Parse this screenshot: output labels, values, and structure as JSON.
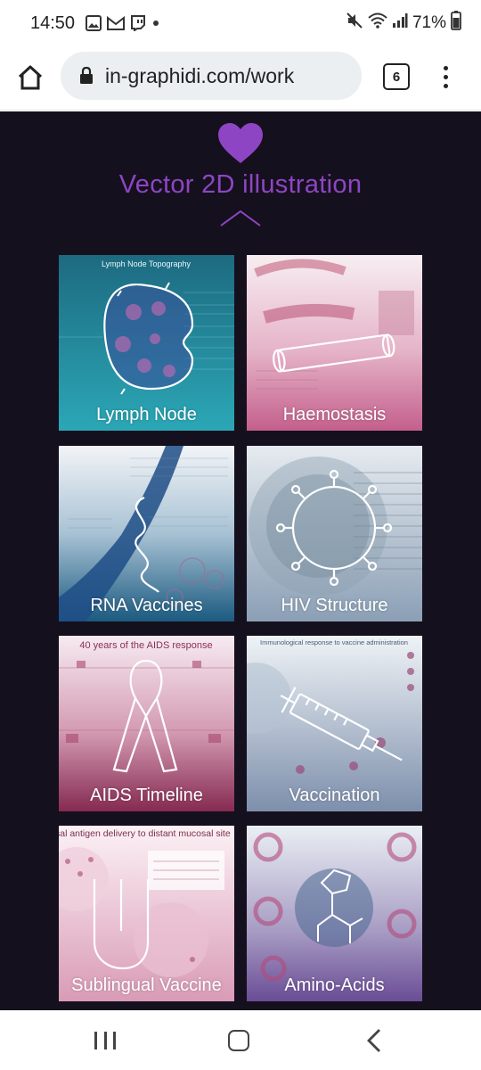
{
  "status_bar": {
    "time": "14:50",
    "notification_icons": [
      "gallery-icon",
      "gmail-icon",
      "twitch-icon",
      "dot-icon"
    ],
    "system_icons": [
      "mute-icon",
      "wifi-icon",
      "signal-icon"
    ],
    "battery_text": "71%"
  },
  "browser": {
    "url": "in-graphidi.com/work",
    "tab_count": "6"
  },
  "section": {
    "title": "Vector 2D illustration",
    "accent_color": "#8e45c4",
    "background_color": "#15101d"
  },
  "cards": [
    {
      "label": "Lymph Node",
      "art_text": "Lymph Node Topography",
      "color_top": "#1f6f86",
      "color_bottom": "#2aa3b3"
    },
    {
      "label": "Haemostasis",
      "art_text": "",
      "color_top": "#f6eaf0",
      "color_bottom": "#c9648f"
    },
    {
      "label": "RNA Vaccines",
      "art_text": "",
      "color_top": "#eef1f4",
      "color_bottom": "#1e5f86"
    },
    {
      "label": "HIV Structure",
      "art_text": "",
      "color_top": "#e3e9ee",
      "color_bottom": "#8fa3b8"
    },
    {
      "label": "AIDS Timeline",
      "art_text": "40 years of the AIDS response",
      "color_top": "#f5e7ee",
      "color_bottom": "#8a2e55"
    },
    {
      "label": "Vaccination",
      "art_text": "Immunological response to vaccine administration",
      "color_top": "#eef2f5",
      "color_bottom": "#7f90ad"
    },
    {
      "label": "Sublingual Vaccine",
      "art_text": "sal antigen delivery to distant mucosal site",
      "color_top": "#fbeff3",
      "color_bottom": "#d9a2b8"
    },
    {
      "label": "Amino-Acids",
      "art_text": "",
      "color_top": "#e9eef3",
      "color_bottom": "#6a4d96"
    }
  ]
}
